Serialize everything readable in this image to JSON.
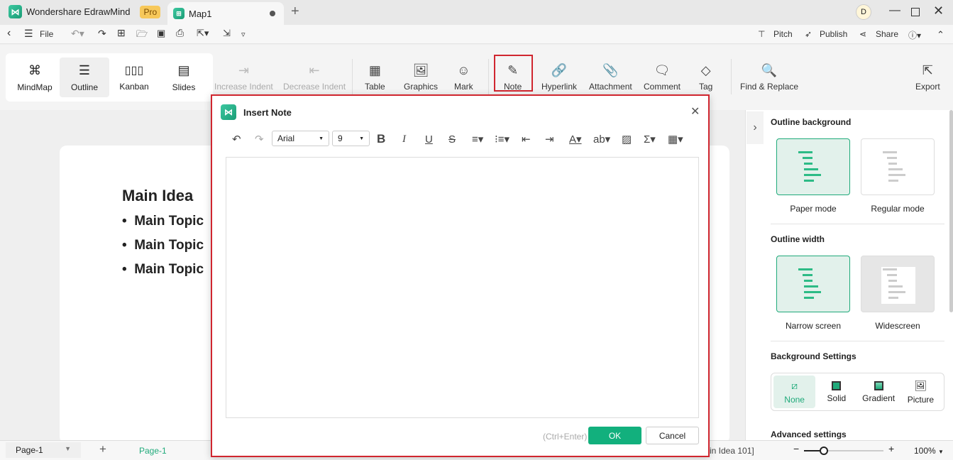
{
  "app": {
    "name": "Wondershare EdrawMind",
    "badge": "Pro",
    "doc_tab": "Map1",
    "user_initial": "D"
  },
  "menu": {
    "file": "File",
    "pitch": "Pitch",
    "publish": "Publish",
    "share": "Share"
  },
  "views": [
    {
      "label": "MindMap",
      "icon": "mindmap-icon"
    },
    {
      "label": "Outline",
      "icon": "outline-icon"
    },
    {
      "label": "Kanban",
      "icon": "kanban-icon"
    },
    {
      "label": "Slides",
      "icon": "slides-icon"
    }
  ],
  "ribbon": {
    "increase_indent": "Increase Indent",
    "decrease_indent": "Decrease Indent",
    "table": "Table",
    "graphics": "Graphics",
    "mark": "Mark",
    "note": "Note",
    "hyperlink": "Hyperlink",
    "attachment": "Attachment",
    "comment": "Comment",
    "tag": "Tag",
    "find_replace": "Find & Replace",
    "export": "Export"
  },
  "outline": {
    "title": "Main Idea",
    "topics": [
      "Main Topic",
      "Main Topic",
      "Main Topic"
    ]
  },
  "panel": {
    "outline_background": "Outline background",
    "paper_mode": "Paper mode",
    "regular_mode": "Regular mode",
    "outline_width": "Outline width",
    "narrow_screen": "Narrow screen",
    "widescreen": "Widescreen",
    "background_settings": "Background Settings",
    "bg_options": [
      "None",
      "Solid",
      "Gradient",
      "Picture"
    ],
    "advanced_settings": "Advanced settings"
  },
  "dialog": {
    "title": "Insert Note",
    "font": "Arial",
    "size": "9",
    "shortcut": "(Ctrl+Enter)",
    "ok": "OK",
    "cancel": "Cancel"
  },
  "status": {
    "page_select": "Page-1",
    "page_tab": "Page-1",
    "info": "in Idea 101]",
    "zoom": "100%",
    "zoom_level": 100
  },
  "colors": {
    "accent": "#1faa7a",
    "highlight": "#d0262f"
  }
}
